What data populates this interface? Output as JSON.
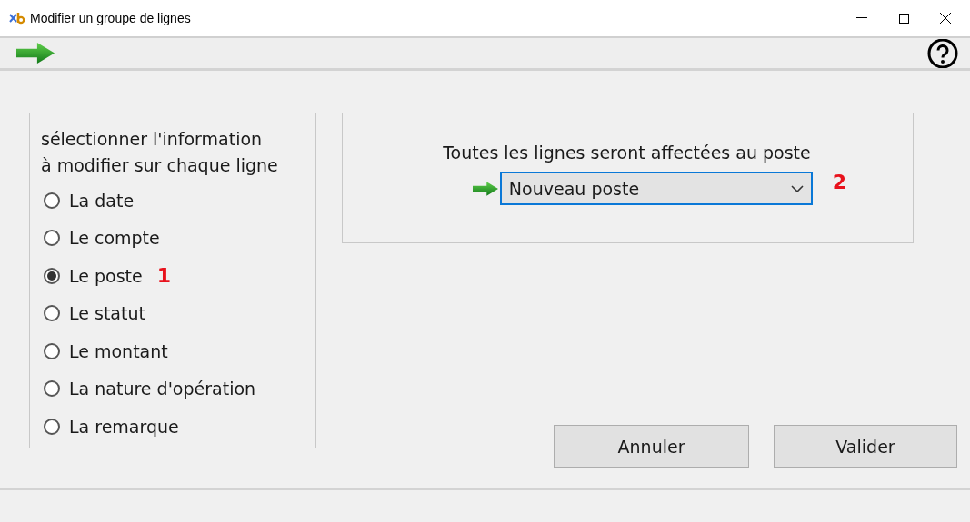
{
  "window": {
    "title": "Modifier un groupe de lignes"
  },
  "selection_panel": {
    "heading": "sélectionner l'information\nà modifier sur chaque ligne",
    "options": [
      {
        "label": "La date",
        "selected": false
      },
      {
        "label": "Le compte",
        "selected": false
      },
      {
        "label": "Le poste",
        "selected": true,
        "callout": "1"
      },
      {
        "label": "Le statut",
        "selected": false
      },
      {
        "label": "Le montant",
        "selected": false
      },
      {
        "label": "La nature d'opération",
        "selected": false
      },
      {
        "label": "La remarque",
        "selected": false
      }
    ]
  },
  "detail_panel": {
    "prompt": "Toutes les lignes seront affectées au poste",
    "dropdown": {
      "value": "Nouveau poste",
      "focused": true,
      "callout": "2"
    }
  },
  "buttons": [
    "Annuler",
    "Valider"
  ]
}
